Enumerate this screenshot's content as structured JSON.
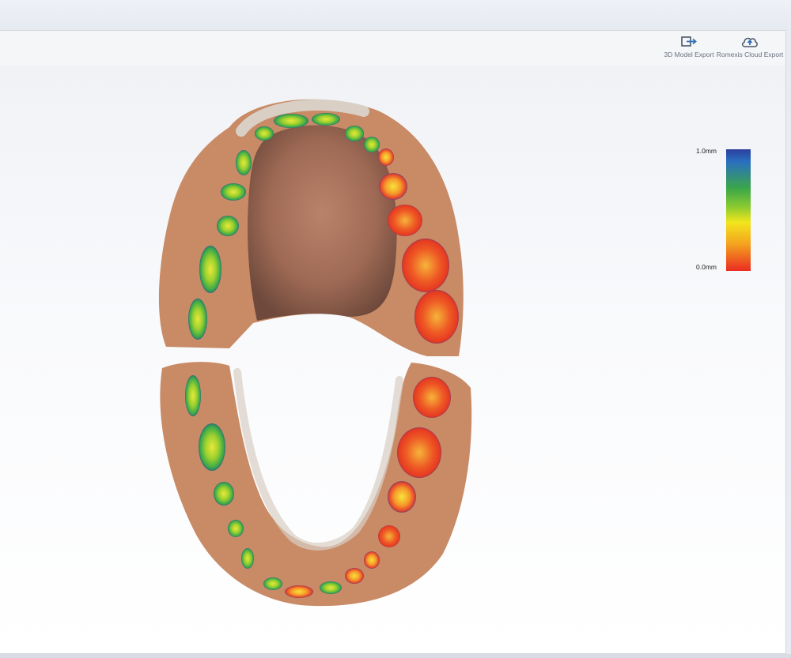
{
  "toolbar": {
    "model_export_label": "3D Model Export",
    "model_export_icon": "export-arrow-icon",
    "cloud_export_label": "Romexis Cloud Export",
    "cloud_export_icon": "cloud-upload-icon"
  },
  "legend": {
    "max_label": "1.0mm",
    "min_label": "0.0mm",
    "colors": [
      "#2b3f9c",
      "#2a6fc0",
      "#3aa64a",
      "#8fcc2e",
      "#f1e61d",
      "#f4a21f",
      "#ea2c22"
    ]
  },
  "viewport": {
    "models": [
      "upper-arch",
      "lower-arch"
    ],
    "accent_tissue": "#c98a66"
  }
}
